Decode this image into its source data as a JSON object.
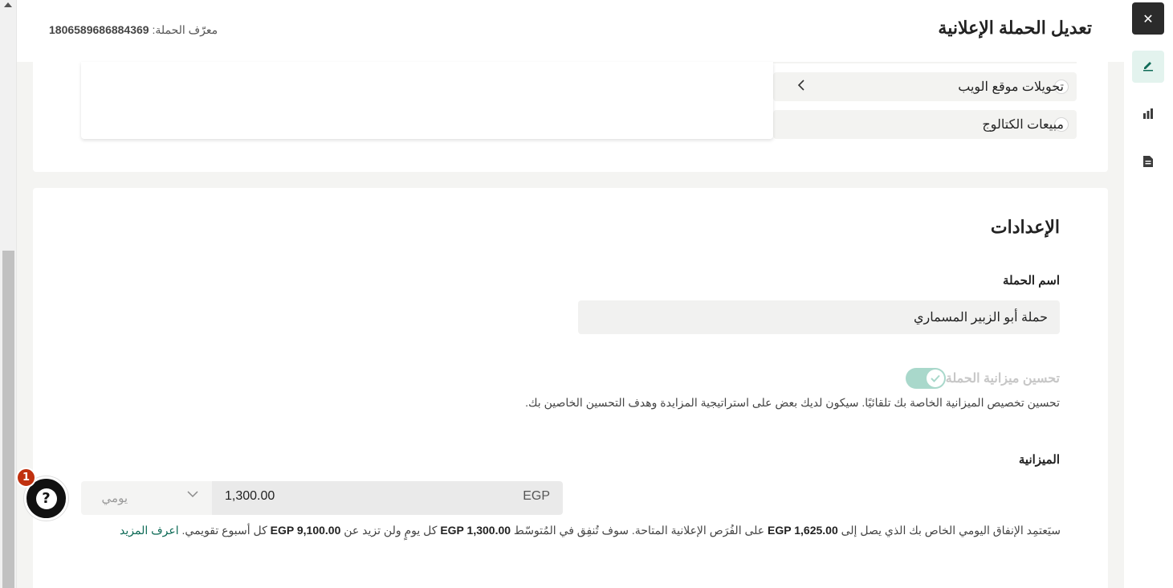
{
  "header": {
    "title": "تعديل الحملة الإعلانية",
    "campaign_id_label": "معرّف الحملة: ",
    "campaign_id_value": "1806589686884369"
  },
  "conversion_options": [
    {
      "label": "تحويلات موقع الويب",
      "selected": false,
      "expandable": true
    },
    {
      "label": "مبيعات الكتالوج",
      "selected": false,
      "expandable": false
    }
  ],
  "settings": {
    "title": "الإعدادات",
    "campaign_name_label": "اسم الحملة",
    "campaign_name_value": "حملة أبو الزبير المسماري",
    "budget_optimization": {
      "label": "تحسين ميزانية الحملة",
      "enabled": true,
      "description": "تحسين تخصيص الميزانية الخاصة بك تلقائيًا. سيكون لديك بعض على استراتيجية المزايدة وهدف التحسين الخاصين بك."
    },
    "budget_label": "الميزانية",
    "budget_currency": "EGP",
    "budget_amount": "1,300.00",
    "budget_period": "يومي",
    "budget_note_part1": "سيَعتمِد الإنفاق اليومي الخاص بك الذي يصل إلى ",
    "budget_note_max_daily": "EGP 1,625.00",
    "budget_note_part2": " على الفُرَص الإعلانية المتاحة. سوف تُنفِق في المُتوسّط ",
    "budget_note_avg": "EGP 1,300.00",
    "budget_note_part3": " كل يومٍ ولن تزيد عن ",
    "budget_note_weekly": "EGP 9,100.00",
    "budget_note_part4": " كل أسبوع تقويمي. ",
    "learn_more": "اعرف المزيد"
  },
  "help": {
    "icon_glyph": "?",
    "badge_count": "1"
  },
  "rail": {
    "close_glyph": "✕",
    "items": [
      "edit-icon",
      "chart-icon",
      "document-icon"
    ]
  },
  "colors": {
    "accent": "#0f6b57",
    "toggle_on_disabled": "#a9d8cb",
    "badge": "#c0310f"
  }
}
